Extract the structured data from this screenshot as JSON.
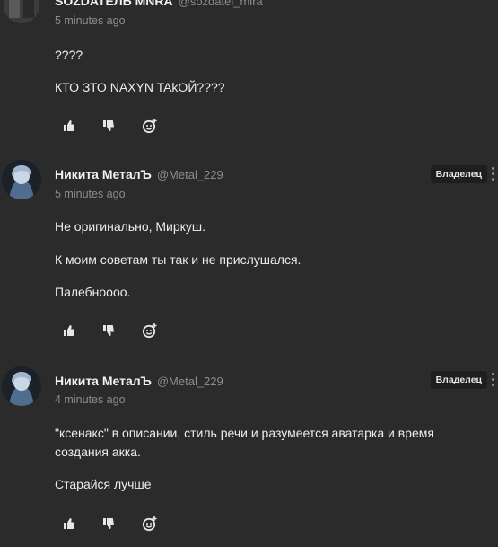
{
  "comments": [
    {
      "author": "SOZDATEЛЬ MNRA",
      "handle": "@sozdatel_mira",
      "time": "5 minutes ago",
      "badge": "",
      "lines": [
        "????",
        "КТО ЗТО NAXYN TAkОЙ????"
      ]
    },
    {
      "author": "Никита МеталЪ",
      "handle": "@Metal_229",
      "time": "5 minutes ago",
      "badge": "Владелец",
      "lines": [
        "Не оригинально, Миркуш.",
        "К моим советам ты так и не прислушался.",
        "Палебноооо."
      ]
    },
    {
      "author": "Никита МеталЪ",
      "handle": "@Metal_229",
      "time": "4 minutes ago",
      "badge": "Владелец",
      "lines": [
        "\"ксенакс\" в описании, стиль речи и разумеется аватарка и время создания акка.",
        "Старайся лучше"
      ]
    }
  ],
  "icons": {
    "like": "thumbs-up-icon",
    "dislike": "thumbs-down-icon",
    "react": "add-emoji-icon"
  },
  "colors": {
    "background": "#2b2b2b",
    "text": "#ededed",
    "muted": "#8d8d8d",
    "badge_bg": "#1e1e1e"
  }
}
